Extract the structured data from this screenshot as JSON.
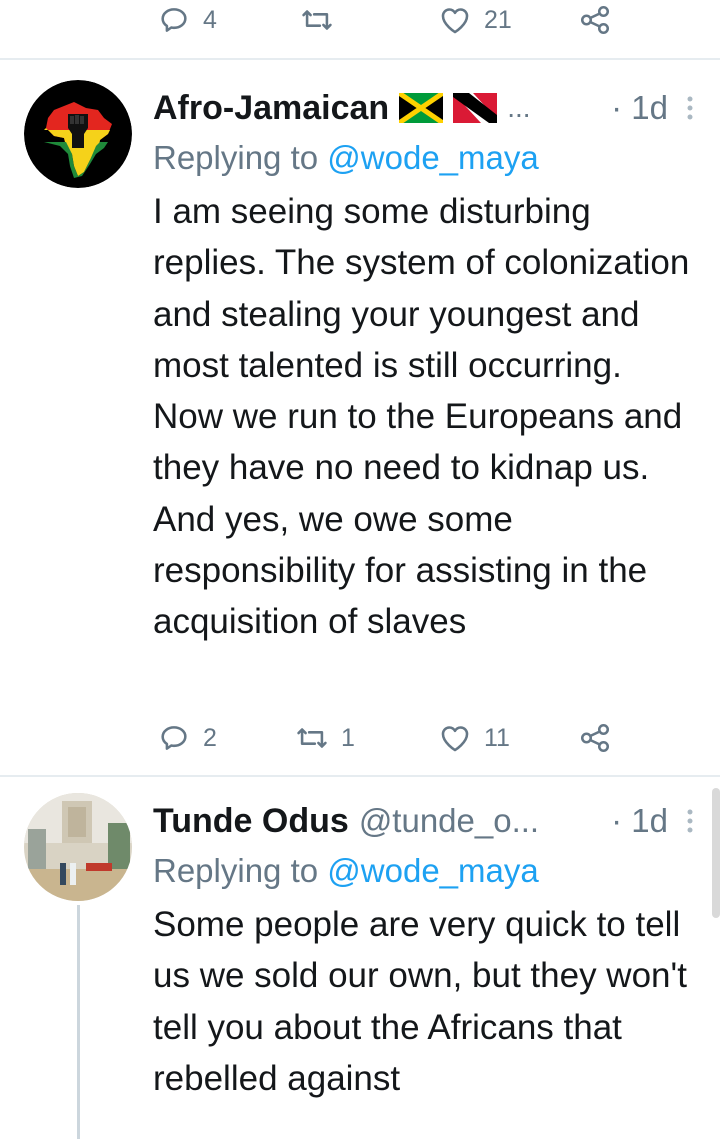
{
  "top_actions": {
    "replies": "4",
    "retweets": "",
    "likes": "21"
  },
  "tweets": [
    {
      "author_name": "Afro-Jamaican",
      "handle": "",
      "flags": [
        "jamaica-flag-icon",
        "trinidad-flag-icon"
      ],
      "ellipsis": "...",
      "time": "· 1d",
      "replying_prefix": "Replying to",
      "replying_to": "@wode_maya",
      "text": "I am seeing some disturbing replies. The system of colonization and stealing your youngest and most talented is still occurring. Now we run to the Europeans and they have no need to kidnap us.  And yes, we owe some responsibility for assisting in the acquisition of slaves",
      "actions": {
        "replies": "2",
        "retweets": "1",
        "likes": "11"
      }
    },
    {
      "author_name": "Tunde Odus",
      "handle": "@tunde_o...",
      "time": "· 1d",
      "replying_prefix": "Replying to",
      "replying_to": "@wode_maya",
      "text": "Some people are very quick to tell us we sold our own, but they won't tell you about the Africans that rebelled against"
    }
  ],
  "colors": {
    "accent": "#1da1f2",
    "secondary_text": "#657786",
    "primary_text": "#14171a",
    "divider": "#e6ecf0"
  }
}
